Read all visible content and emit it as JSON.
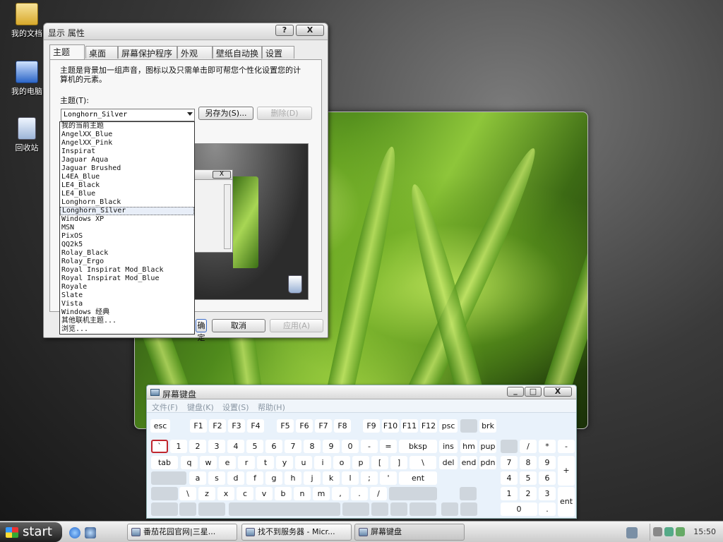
{
  "desktop": {
    "icons": [
      {
        "label": "我的文档",
        "icon": "my-documents-icon"
      },
      {
        "label": "我的电脑",
        "icon": "my-computer-icon"
      },
      {
        "label": "回收站",
        "icon": "recycle-bin-icon"
      }
    ]
  },
  "dialog": {
    "title": "显示 属性",
    "help_label": "?",
    "close_label": "X",
    "tabs": [
      "主题",
      "桌面",
      "屏幕保护程序",
      "外观",
      "壁纸自动换",
      "设置"
    ],
    "description": "主题是背景加一组声音，图标以及只需单击即可帮您个性化设置您的计算机的元素。",
    "theme_label": "主题(T):",
    "selected_theme": "Longhorn_Silver",
    "save_as_label": "另存为(S)...",
    "delete_label": "删除(D)",
    "ok_label": "确定",
    "cancel_label": "取消",
    "apply_label": "应用(A)",
    "preview_close": "X",
    "theme_options": [
      "我的当前主题",
      "AngelXX_Blue",
      "AngelXX_Pink",
      "Inspirat",
      "Jaguar Aqua",
      "Jaguar Brushed",
      "L4EA_Blue",
      "LE4_Black",
      "LE4_Blue",
      "Longhorn_Black",
      "Longhorn_Silver",
      "Windows XP",
      "MSN",
      "PixOS",
      "QQ2k5",
      "Rolay_Black",
      "Rolay_Ergo",
      "Royal Inspirat Mod_Black",
      "Royal Inspirat Mod_Blue",
      "Royale",
      "Slate",
      "Vista",
      "Windows 经典",
      "其他联机主题...",
      "浏览..."
    ],
    "selected_index": 10
  },
  "keyboard": {
    "title": "屏幕键盘",
    "menu": [
      "文件(F)",
      "键盘(K)",
      "设置(S)",
      "帮助(H)"
    ],
    "rows": {
      "r1": [
        "esc",
        "F1",
        "F2",
        "F3",
        "F4",
        "F5",
        "F6",
        "F7",
        "F8",
        "F9",
        "F10",
        "F11",
        "F12",
        "psc",
        "",
        "brk"
      ],
      "r2": [
        "`",
        "1",
        "2",
        "3",
        "4",
        "5",
        "6",
        "7",
        "8",
        "9",
        "0",
        "-",
        "=",
        "bksp",
        "ins",
        "hm",
        "pup",
        "",
        "/",
        "*",
        "-"
      ],
      "r3": [
        "tab",
        "q",
        "w",
        "e",
        "r",
        "t",
        "y",
        "u",
        "i",
        "o",
        "p",
        "[",
        "]",
        "\\",
        "del",
        "end",
        "pdn",
        "7",
        "8",
        "9",
        "+"
      ],
      "r4": [
        "",
        "a",
        "s",
        "d",
        "f",
        "g",
        "h",
        "j",
        "k",
        "l",
        ";",
        "'",
        "ent",
        "4",
        "5",
        "6"
      ],
      "r5": [
        "",
        "\\",
        "z",
        "x",
        "c",
        "v",
        "b",
        "n",
        "m",
        ",",
        ".",
        "/",
        "",
        "",
        "1",
        "2",
        "3",
        "ent"
      ],
      "r6": [
        "",
        "",
        "",
        "",
        "",
        "",
        "",
        "",
        "",
        "",
        "0",
        "."
      ]
    }
  },
  "taskbar": {
    "start_label": "start",
    "tasks": [
      "番茄花园官网|三星...",
      "找不到服务器 - Micr...",
      "屏幕键盘"
    ],
    "clock": "15:50"
  },
  "colors": {
    "highlight_key_border": "#c0262e",
    "keyboard_bg": "#e9f2fb"
  }
}
